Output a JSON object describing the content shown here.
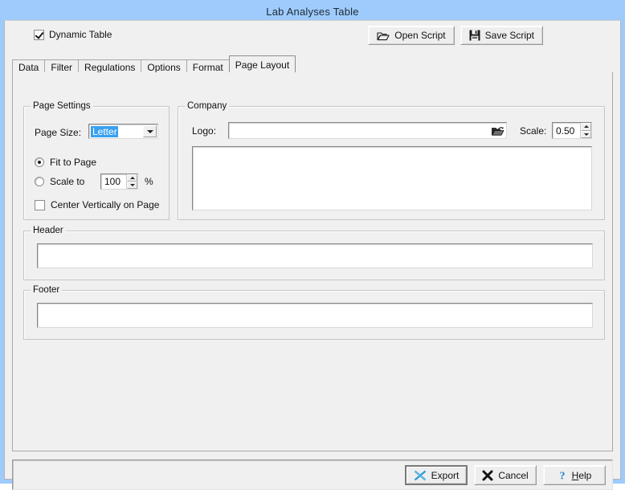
{
  "window": {
    "title": "Lab Analyses Table",
    "titlebar_color": "#9ecbfb",
    "face_color": "#f0f0f0"
  },
  "toolbar": {
    "dynamic_table_label": "Dynamic Table",
    "dynamic_table_checked": true,
    "open_script_label": "Open Script",
    "save_script_label": "Save Script"
  },
  "tabs": [
    {
      "label": "Data",
      "active": false
    },
    {
      "label": "Filter",
      "active": false
    },
    {
      "label": "Regulations",
      "active": false
    },
    {
      "label": "Options",
      "active": false
    },
    {
      "label": "Format",
      "active": false
    },
    {
      "label": "Page Layout",
      "active": true
    }
  ],
  "page_settings": {
    "legend": "Page Settings",
    "page_size_label": "Page Size:",
    "page_size_value": "Letter",
    "page_size_selected": true,
    "fit_to_page_label": "Fit to Page",
    "fit_to_page_selected": true,
    "scale_to_label": "Scale to",
    "scale_to_selected": false,
    "scale_to_value": "100",
    "percent_label": "%",
    "center_vertically_label": "Center Vertically on Page",
    "center_vertically_checked": false
  },
  "company": {
    "legend": "Company",
    "logo_label": "Logo:",
    "logo_value": "",
    "logo_placeholder": "",
    "browse_icon": "open-folder-icon",
    "scale_label": "Scale:",
    "scale_value": "0.50",
    "preview_value": ""
  },
  "header": {
    "legend": "Header",
    "value": "",
    "placeholder": ""
  },
  "footer": {
    "legend": "Footer",
    "value": "",
    "placeholder": ""
  },
  "actions": {
    "export_label": "Export",
    "cancel_label": "Cancel",
    "help_label": "Help",
    "help_mnemonic": "H",
    "help_rest": "elp"
  },
  "colors": {
    "selection_blue": "#3aa0ef",
    "export_icon": "#2b9ad6",
    "help_icon": "#2a7fd4",
    "cancel_icon": "#111111"
  }
}
